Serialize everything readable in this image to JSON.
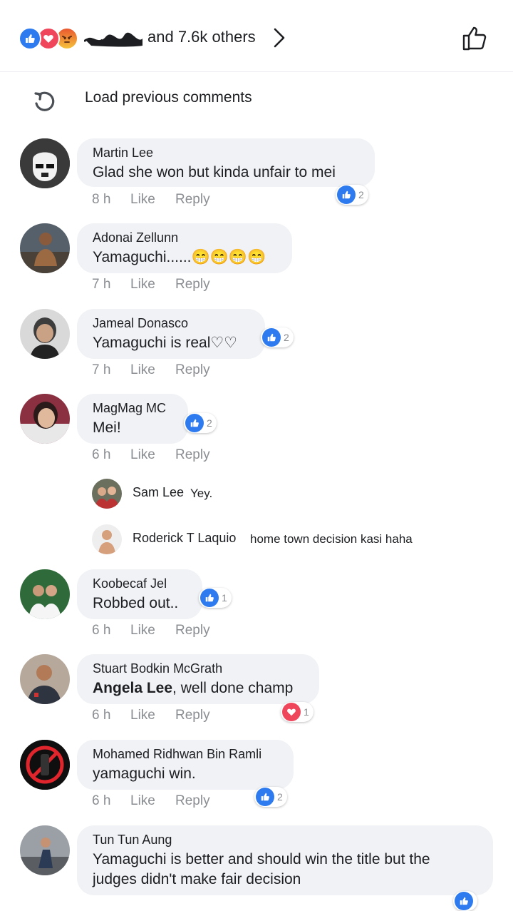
{
  "header": {
    "reaction_summary_suffix": "and 7.6k others",
    "reaction_types": [
      "like-icon",
      "love-icon",
      "angry-icon"
    ]
  },
  "load_previous": {
    "label": "Load previous comments"
  },
  "actions": {
    "like": "Like",
    "reply": "Reply"
  },
  "comments": [
    {
      "author": "Martin Lee",
      "text": "Glad she won but kinda unfair to mei",
      "time": "8 h",
      "reaction": "like",
      "count": "2"
    },
    {
      "author": "Adonai Zellunn",
      "text": "Yamaguchi......😁😁😁😁",
      "time": "7 h",
      "reaction": "",
      "count": ""
    },
    {
      "author": "Jameal Donasco",
      "text": "Yamaguchi is real♡♡",
      "time": "7 h",
      "reaction": "like",
      "count": "2"
    },
    {
      "author": "MagMag MC",
      "text": "Mei!",
      "time": "6 h",
      "reaction": "like",
      "count": "2"
    },
    {
      "author": "Koobecaf Jel",
      "text": "Robbed out..",
      "time": "6 h",
      "reaction": "like",
      "count": "1"
    },
    {
      "author": "Stuart Bodkin McGrath",
      "text_tag": "Angela Lee",
      "text": ", well done champ",
      "time": "6 h",
      "reaction": "love",
      "count": "1"
    },
    {
      "author": "Mohamed Ridhwan Bin Ramli",
      "text": "yamaguchi win.",
      "time": "6 h",
      "reaction": "like",
      "count": "2"
    },
    {
      "author": "Tun Tun Aung",
      "text": "Yamaguchi is better and should win the title but the judges didn't make fair decision",
      "time": "",
      "reaction": "like",
      "count": ""
    }
  ],
  "replies": [
    {
      "author": "Sam Lee",
      "text": "Yey."
    },
    {
      "author": "Roderick T Laquio",
      "text": "home town decision kasi haha"
    }
  ],
  "colors": {
    "like_blue": "#2e7bf0",
    "love_red": "#f0465c",
    "bubble_bg": "#f0f2f5",
    "meta_gray": "#8a8d91"
  }
}
